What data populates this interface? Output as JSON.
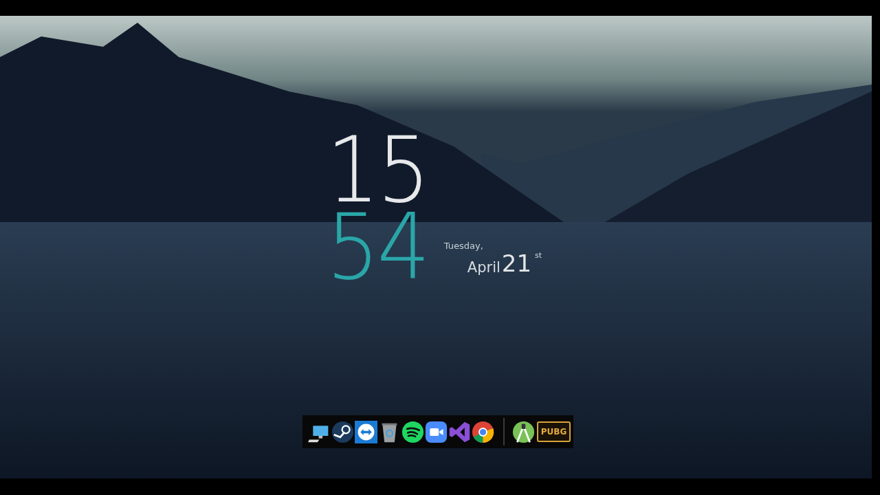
{
  "clock": {
    "hour": "15",
    "minute": "54"
  },
  "date": {
    "weekday": "Tuesday,",
    "month": "April",
    "day": "21",
    "suffix": "st"
  },
  "dock": {
    "apps": [
      {
        "kind": "computer"
      },
      {
        "kind": "steam"
      },
      {
        "kind": "remote"
      },
      {
        "kind": "bin"
      },
      {
        "kind": "music"
      },
      {
        "kind": "video"
      },
      {
        "kind": "studio"
      },
      {
        "kind": "browser"
      }
    ],
    "pinned": [
      {
        "kind": "android"
      },
      {
        "kind": "game",
        "label": "PUBG"
      }
    ]
  }
}
